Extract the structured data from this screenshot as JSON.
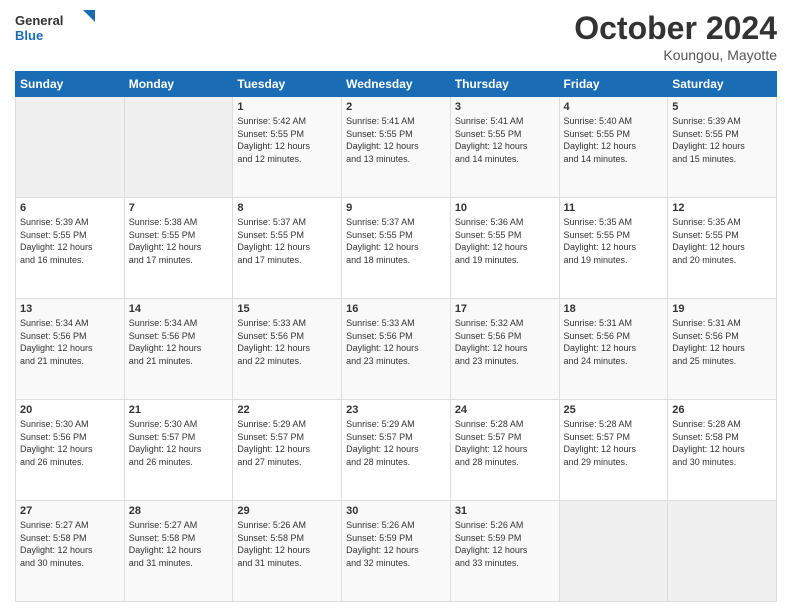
{
  "logo": {
    "line1": "General",
    "line2": "Blue"
  },
  "title": "October 2024",
  "location": "Koungou, Mayotte",
  "days_of_week": [
    "Sunday",
    "Monday",
    "Tuesday",
    "Wednesday",
    "Thursday",
    "Friday",
    "Saturday"
  ],
  "weeks": [
    [
      {
        "day": "",
        "info": ""
      },
      {
        "day": "",
        "info": ""
      },
      {
        "day": "1",
        "info": "Sunrise: 5:42 AM\nSunset: 5:55 PM\nDaylight: 12 hours\nand 12 minutes."
      },
      {
        "day": "2",
        "info": "Sunrise: 5:41 AM\nSunset: 5:55 PM\nDaylight: 12 hours\nand 13 minutes."
      },
      {
        "day": "3",
        "info": "Sunrise: 5:41 AM\nSunset: 5:55 PM\nDaylight: 12 hours\nand 14 minutes."
      },
      {
        "day": "4",
        "info": "Sunrise: 5:40 AM\nSunset: 5:55 PM\nDaylight: 12 hours\nand 14 minutes."
      },
      {
        "day": "5",
        "info": "Sunrise: 5:39 AM\nSunset: 5:55 PM\nDaylight: 12 hours\nand 15 minutes."
      }
    ],
    [
      {
        "day": "6",
        "info": "Sunrise: 5:39 AM\nSunset: 5:55 PM\nDaylight: 12 hours\nand 16 minutes."
      },
      {
        "day": "7",
        "info": "Sunrise: 5:38 AM\nSunset: 5:55 PM\nDaylight: 12 hours\nand 17 minutes."
      },
      {
        "day": "8",
        "info": "Sunrise: 5:37 AM\nSunset: 5:55 PM\nDaylight: 12 hours\nand 17 minutes."
      },
      {
        "day": "9",
        "info": "Sunrise: 5:37 AM\nSunset: 5:55 PM\nDaylight: 12 hours\nand 18 minutes."
      },
      {
        "day": "10",
        "info": "Sunrise: 5:36 AM\nSunset: 5:55 PM\nDaylight: 12 hours\nand 19 minutes."
      },
      {
        "day": "11",
        "info": "Sunrise: 5:35 AM\nSunset: 5:55 PM\nDaylight: 12 hours\nand 19 minutes."
      },
      {
        "day": "12",
        "info": "Sunrise: 5:35 AM\nSunset: 5:55 PM\nDaylight: 12 hours\nand 20 minutes."
      }
    ],
    [
      {
        "day": "13",
        "info": "Sunrise: 5:34 AM\nSunset: 5:56 PM\nDaylight: 12 hours\nand 21 minutes."
      },
      {
        "day": "14",
        "info": "Sunrise: 5:34 AM\nSunset: 5:56 PM\nDaylight: 12 hours\nand 21 minutes."
      },
      {
        "day": "15",
        "info": "Sunrise: 5:33 AM\nSunset: 5:56 PM\nDaylight: 12 hours\nand 22 minutes."
      },
      {
        "day": "16",
        "info": "Sunrise: 5:33 AM\nSunset: 5:56 PM\nDaylight: 12 hours\nand 23 minutes."
      },
      {
        "day": "17",
        "info": "Sunrise: 5:32 AM\nSunset: 5:56 PM\nDaylight: 12 hours\nand 23 minutes."
      },
      {
        "day": "18",
        "info": "Sunrise: 5:31 AM\nSunset: 5:56 PM\nDaylight: 12 hours\nand 24 minutes."
      },
      {
        "day": "19",
        "info": "Sunrise: 5:31 AM\nSunset: 5:56 PM\nDaylight: 12 hours\nand 25 minutes."
      }
    ],
    [
      {
        "day": "20",
        "info": "Sunrise: 5:30 AM\nSunset: 5:56 PM\nDaylight: 12 hours\nand 26 minutes."
      },
      {
        "day": "21",
        "info": "Sunrise: 5:30 AM\nSunset: 5:57 PM\nDaylight: 12 hours\nand 26 minutes."
      },
      {
        "day": "22",
        "info": "Sunrise: 5:29 AM\nSunset: 5:57 PM\nDaylight: 12 hours\nand 27 minutes."
      },
      {
        "day": "23",
        "info": "Sunrise: 5:29 AM\nSunset: 5:57 PM\nDaylight: 12 hours\nand 28 minutes."
      },
      {
        "day": "24",
        "info": "Sunrise: 5:28 AM\nSunset: 5:57 PM\nDaylight: 12 hours\nand 28 minutes."
      },
      {
        "day": "25",
        "info": "Sunrise: 5:28 AM\nSunset: 5:57 PM\nDaylight: 12 hours\nand 29 minutes."
      },
      {
        "day": "26",
        "info": "Sunrise: 5:28 AM\nSunset: 5:58 PM\nDaylight: 12 hours\nand 30 minutes."
      }
    ],
    [
      {
        "day": "27",
        "info": "Sunrise: 5:27 AM\nSunset: 5:58 PM\nDaylight: 12 hours\nand 30 minutes."
      },
      {
        "day": "28",
        "info": "Sunrise: 5:27 AM\nSunset: 5:58 PM\nDaylight: 12 hours\nand 31 minutes."
      },
      {
        "day": "29",
        "info": "Sunrise: 5:26 AM\nSunset: 5:58 PM\nDaylight: 12 hours\nand 31 minutes."
      },
      {
        "day": "30",
        "info": "Sunrise: 5:26 AM\nSunset: 5:59 PM\nDaylight: 12 hours\nand 32 minutes."
      },
      {
        "day": "31",
        "info": "Sunrise: 5:26 AM\nSunset: 5:59 PM\nDaylight: 12 hours\nand 33 minutes."
      },
      {
        "day": "",
        "info": ""
      },
      {
        "day": "",
        "info": ""
      }
    ]
  ]
}
